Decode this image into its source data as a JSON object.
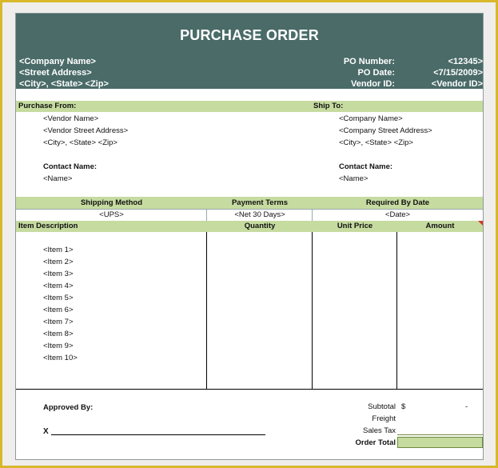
{
  "header": {
    "title": "PURCHASE ORDER",
    "company_name": "<Company Name>",
    "street_address": "<Street Address>",
    "city_state_zip": "<City>, <State> <Zip>",
    "po_number_label": "PO Number:",
    "po_number_value": "<12345>",
    "po_date_label": "PO Date:",
    "po_date_value": "<7/15/2009>",
    "vendor_id_label": "Vendor ID:",
    "vendor_id_value": "<Vendor ID>"
  },
  "purchase_from": {
    "heading": "Purchase From:",
    "vendor_name": "<Vendor Name>",
    "vendor_street": "<Vendor Street Address>",
    "city_state_zip": "<City>, <State> <Zip>",
    "contact_label": "Contact Name:",
    "contact_name": "<Name>"
  },
  "ship_to": {
    "heading": "Ship To:",
    "company_name": "<Company Name>",
    "street": "<Company Street Address>",
    "city_state_zip": "<City>, <State> <Zip>",
    "contact_label": "Contact Name:",
    "contact_name": "<Name>"
  },
  "terms": {
    "shipping_method_label": "Shipping Method",
    "payment_terms_label": "Payment Terms",
    "required_by_label": "Required By Date",
    "shipping_method": "<UPS>",
    "payment_terms": "<Net 30 Days>",
    "required_by": "<Date>"
  },
  "items_table": {
    "col_description": "Item Description",
    "col_quantity": "Quantity",
    "col_unit_price": "Unit Price",
    "col_amount": "Amount",
    "items": [
      "<Item 1>",
      "<Item 2>",
      "<Item 3>",
      "<Item 4>",
      "<Item 5>",
      "<Item 6>",
      "<Item 7>",
      "<Item 8>",
      "<Item 9>",
      "<Item 10>"
    ]
  },
  "footer": {
    "approved_by_label": "Approved By:",
    "signature_x": "X",
    "subtotal_label": "Subtotal",
    "subtotal_currency": "$",
    "subtotal_value": "-",
    "freight_label": "Freight",
    "sales_tax_label": "Sales Tax",
    "order_total_label": "Order Total"
  },
  "colors": {
    "header_bg": "#4a6b68",
    "band_bg": "#c6dba0",
    "frame_border": "#d8b82a",
    "comment_marker": "#d23a2a"
  }
}
